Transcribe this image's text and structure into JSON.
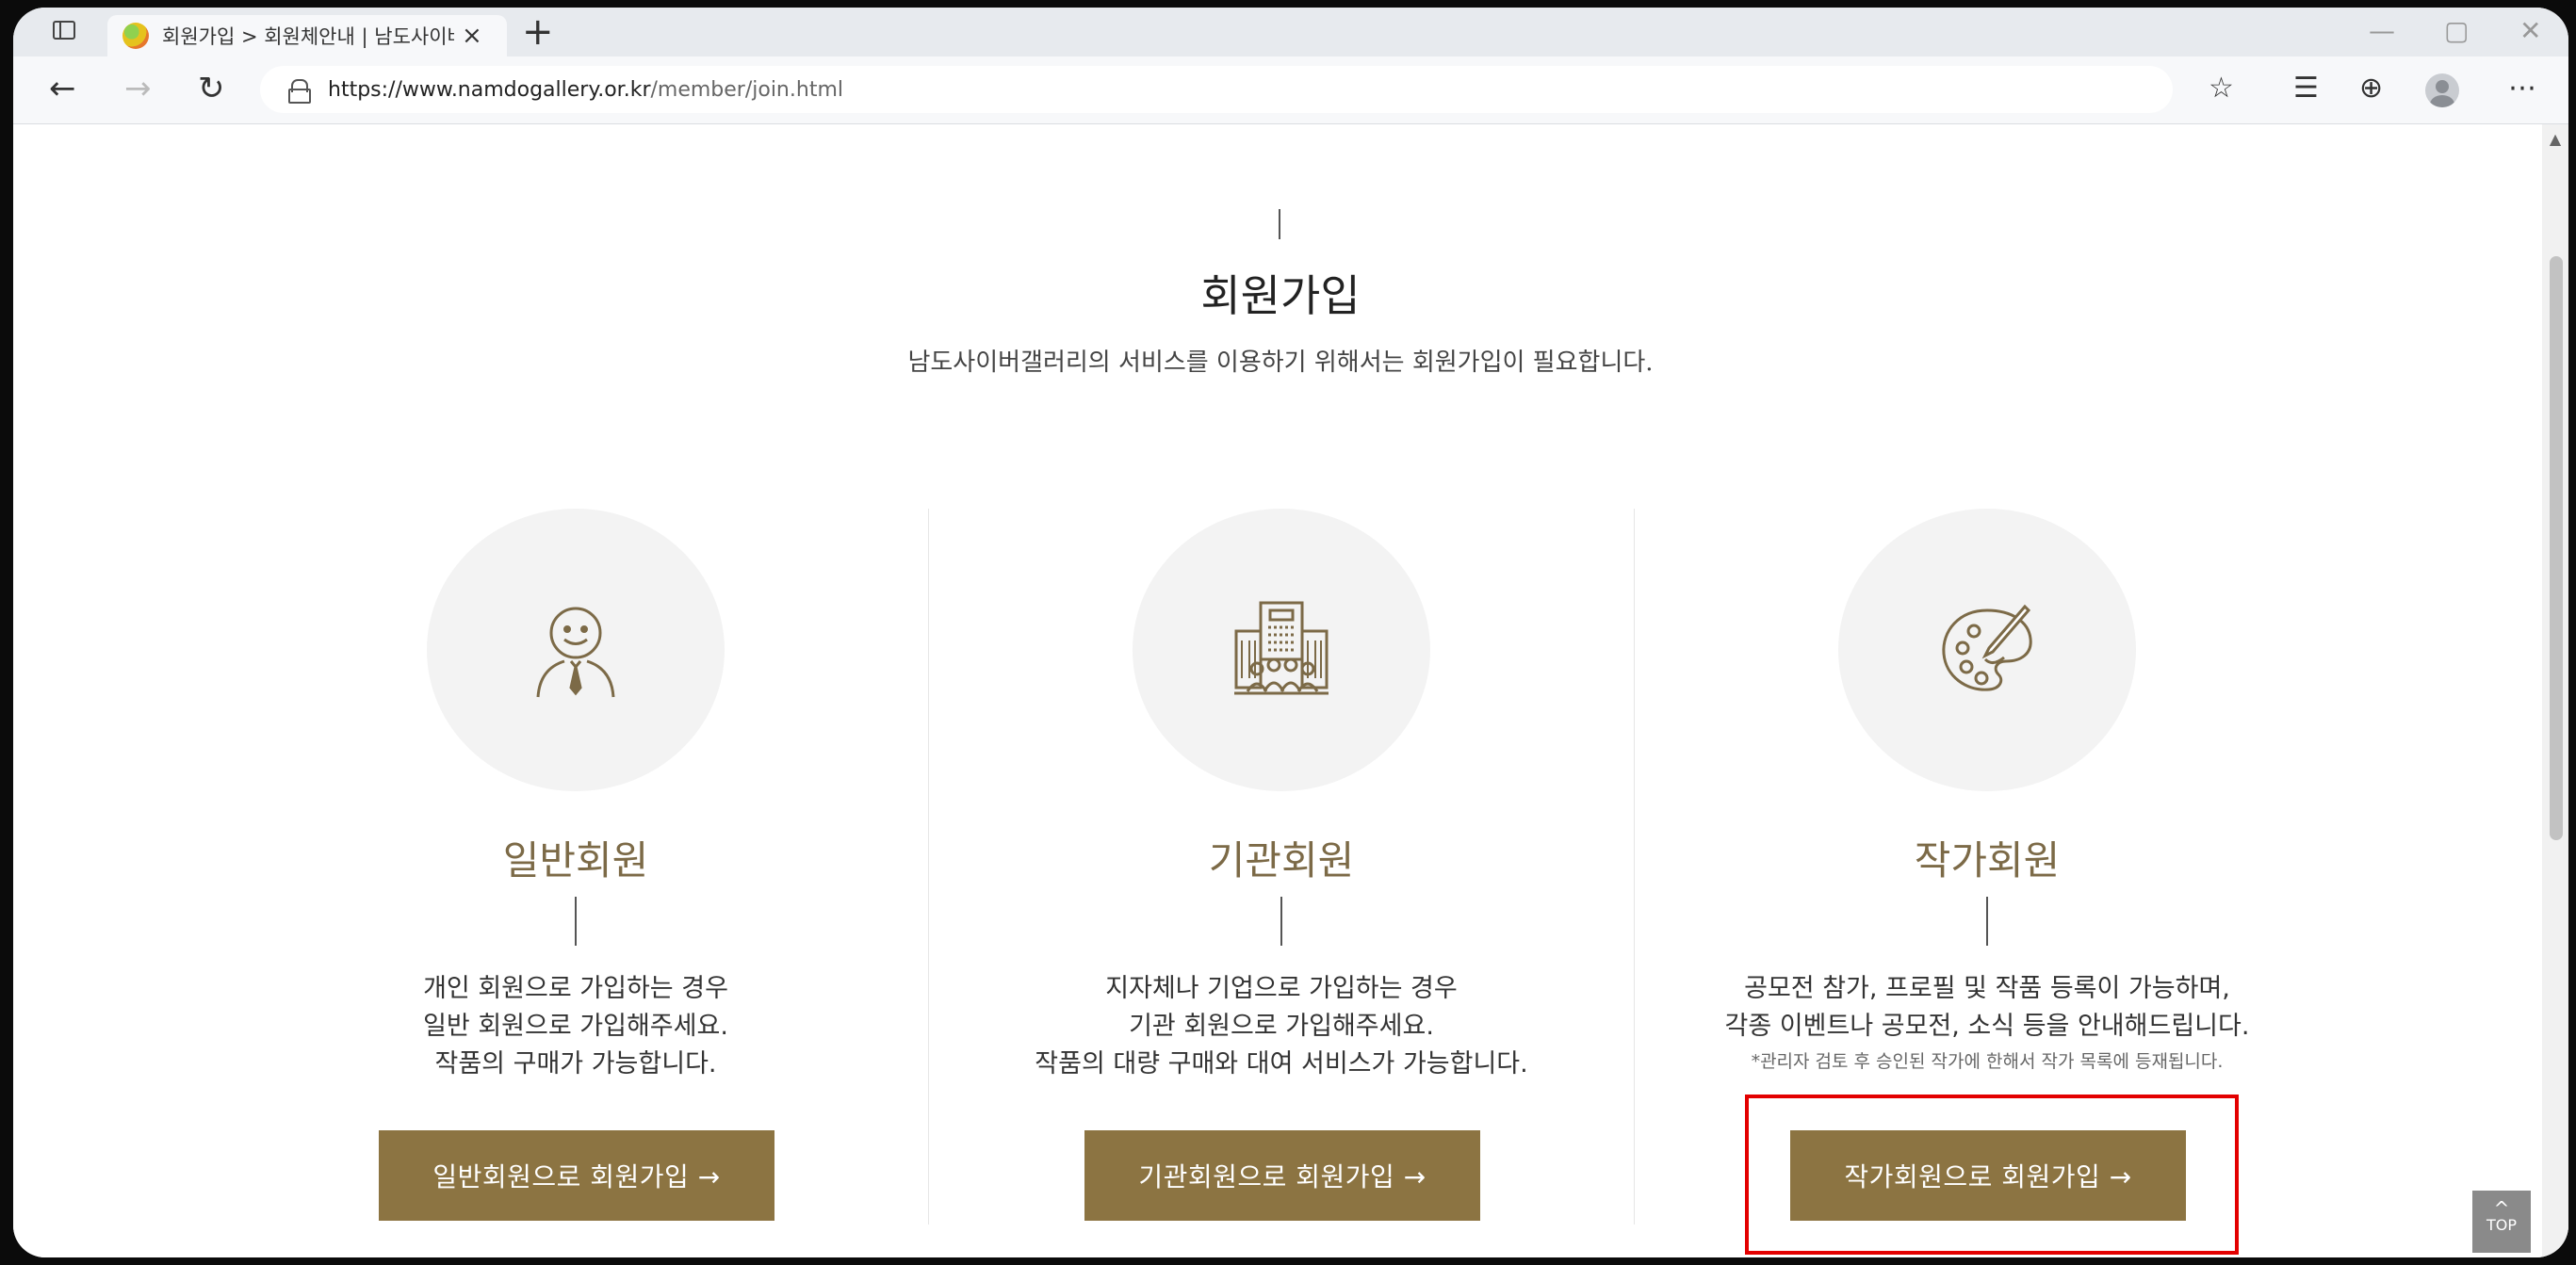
{
  "browser": {
    "tab_title": "회원가입 > 회원체안내 | 남도사이버갤러리",
    "tab_close": "×",
    "new_tab": "+",
    "url_host": "https://www.namdogallery.or.kr",
    "url_path": "/member/join.html",
    "win_minimize": "—",
    "win_restore": "▢",
    "win_close": "✕",
    "icons": [
      "back-icon",
      "forward-icon",
      "refresh-icon",
      "lock-icon",
      "favorites-add-icon",
      "favorites-icon",
      "collections-icon",
      "profile-icon",
      "more-icon"
    ]
  },
  "page": {
    "title": "회원가입",
    "subtitle": "남도사이버갤러리의 서비스를 이용하기 위해서는 회원가입이 필요합니다."
  },
  "cards": [
    {
      "name": "일반회원",
      "icon": "person-tie-icon",
      "desc": [
        "개인 회원으로 가입하는 경우",
        "일반 회원으로 가입해주세요.",
        "작품의 구매가 가능합니다."
      ],
      "note": "",
      "button": "일반회원으로 회원가입 →"
    },
    {
      "name": "기관회원",
      "icon": "building-people-icon",
      "desc": [
        "지자체나 기업으로 가입하는 경우",
        "기관 회원으로 가입해주세요.",
        "작품의 대량 구매와 대여 서비스가 가능합니다."
      ],
      "note": "",
      "button": "기관회원으로 회원가입 →"
    },
    {
      "name": "작가회원",
      "icon": "palette-brush-icon",
      "desc": [
        "공모전 참가, 프로필 및 작품 등록이 가능하며,",
        "각종 이벤트나 공모전, 소식 등을 안내해드립니다."
      ],
      "note": "*관리자 검토 후 승인된 작가에 한해서 작가 목록에 등재됩니다.",
      "button": "작가회원으로 회원가입 →"
    }
  ],
  "top_button": {
    "arrow": "^",
    "label": "TOP"
  },
  "colors": {
    "accent": "#8c7442",
    "title_gold": "#7c6a47",
    "highlight": "#e30000"
  }
}
